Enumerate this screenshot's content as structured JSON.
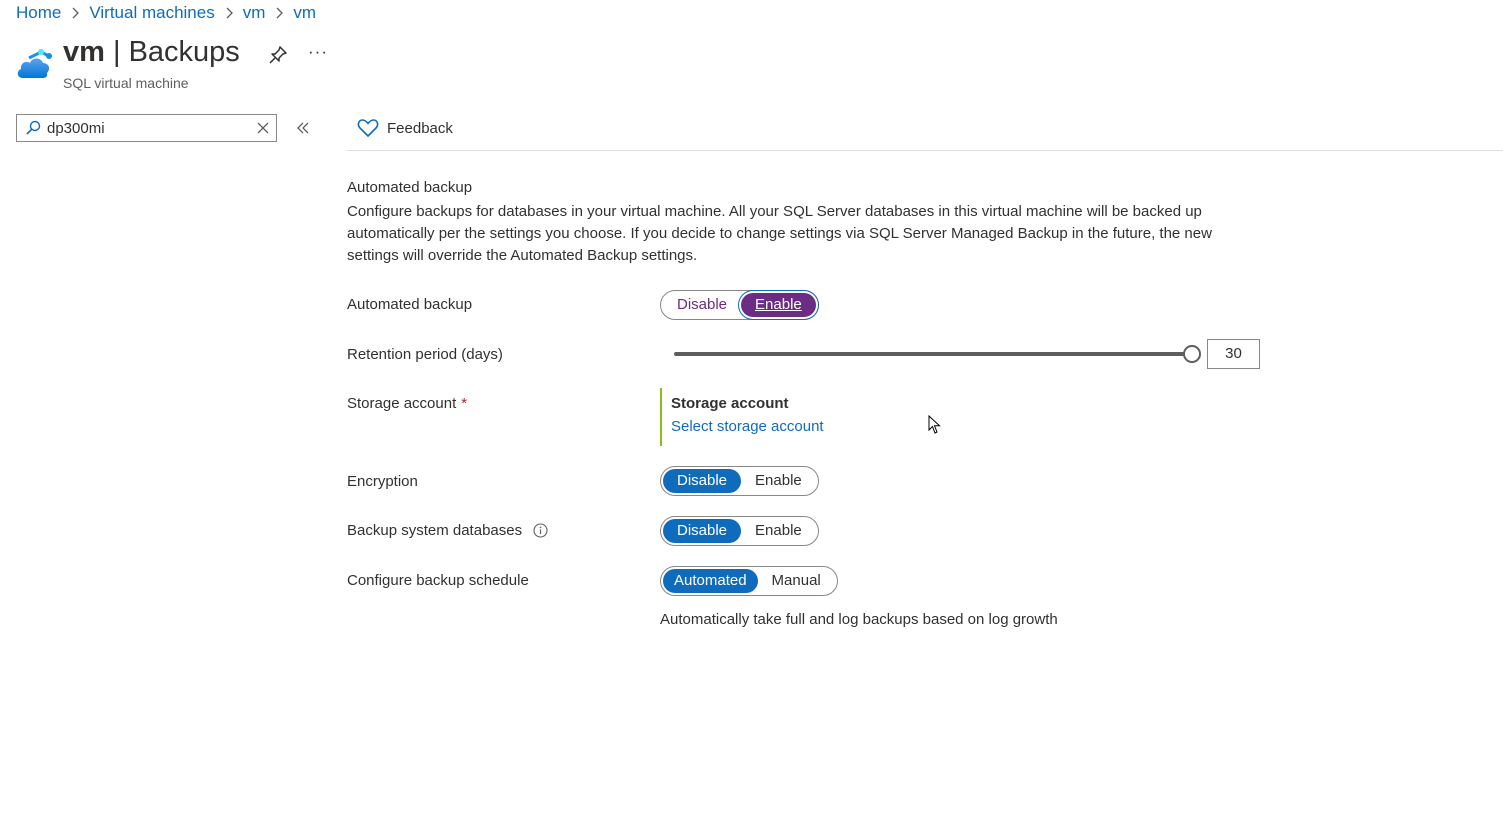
{
  "breadcrumb": [
    "Home",
    "Virtual machines",
    "vm",
    "vm"
  ],
  "header": {
    "resource_name": "vm",
    "separator": " | ",
    "page_name": "Backups",
    "subtitle": "SQL virtual machine",
    "more_label": "···"
  },
  "search": {
    "value": "dp300mi"
  },
  "commands": {
    "feedback": "Feedback"
  },
  "description": {
    "title": "Automated backup",
    "text": "Configure backups for databases in your virtual machine. All your SQL Server databases in this virtual machine will be backed up automatically per the settings you choose. If you decide to change settings via SQL Server Managed Backup in the future, the new settings will override the Automated Backup settings."
  },
  "form": {
    "automated_backup": {
      "label": "Automated backup",
      "options": [
        "Disable",
        "Enable"
      ],
      "selected": "Enable"
    },
    "retention": {
      "label": "Retention period (days)",
      "value": "30",
      "fraction": 1.0
    },
    "storage": {
      "label": "Storage account",
      "required_mark": "*",
      "box_title": "Storage account",
      "link": "Select storage account"
    },
    "encryption": {
      "label": "Encryption",
      "options": [
        "Disable",
        "Enable"
      ],
      "selected": "Disable"
    },
    "backup_system_db": {
      "label": "Backup system databases",
      "options": [
        "Disable",
        "Enable"
      ],
      "selected": "Disable"
    },
    "schedule": {
      "label": "Configure backup schedule",
      "options": [
        "Automated",
        "Manual"
      ],
      "selected": "Automated",
      "note": "Automatically take full and log backups based on log growth"
    }
  },
  "colors": {
    "accent": "#0f6cbd",
    "enable_selected": "#6b2c84",
    "storage_bar": "#8cbd18",
    "required": "#a4262c"
  },
  "icons": [
    "sql-vm-cloud-icon",
    "pin-icon",
    "search-icon",
    "clear-icon",
    "collapse-chevrons-icon",
    "heart-icon",
    "info-icon",
    "chevron-right-icon",
    "mouse-cursor-icon"
  ]
}
